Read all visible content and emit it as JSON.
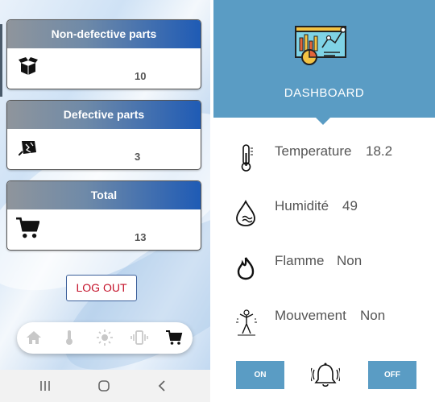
{
  "left": {
    "cards": [
      {
        "title": "Non-defective parts",
        "value": "10",
        "icon": "open-box-icon"
      },
      {
        "title": "Defective parts",
        "value": "3",
        "icon": "broken-box-icon"
      },
      {
        "title": "Total",
        "value": "13",
        "icon": "shopping-cart-icon"
      }
    ],
    "logout_label": "LOG OUT",
    "nav_icons": [
      "home-icon",
      "thermometer-icon",
      "sun-icon",
      "vibration-icon",
      "shopping-cart-icon"
    ],
    "system_nav": [
      "recent-apps-icon",
      "home-circle-icon",
      "back-icon"
    ]
  },
  "right": {
    "dashboard_title": "DASHBOARD",
    "sensors": [
      {
        "label": "Temperature",
        "value": "18.2",
        "icon": "thermometer-icon"
      },
      {
        "label": "Humidité",
        "value": "49",
        "icon": "humidity-icon"
      },
      {
        "label": "Flamme",
        "value": "Non",
        "icon": "flame-icon"
      },
      {
        "label": "Mouvement",
        "value": "Non",
        "icon": "motion-icon"
      }
    ],
    "on_label": "ON",
    "off_label": "OFF"
  },
  "colors": {
    "header_blue": "#5a9cc4",
    "card_gradient_end": "#1f5bb5",
    "logout_red": "#c4122a"
  }
}
